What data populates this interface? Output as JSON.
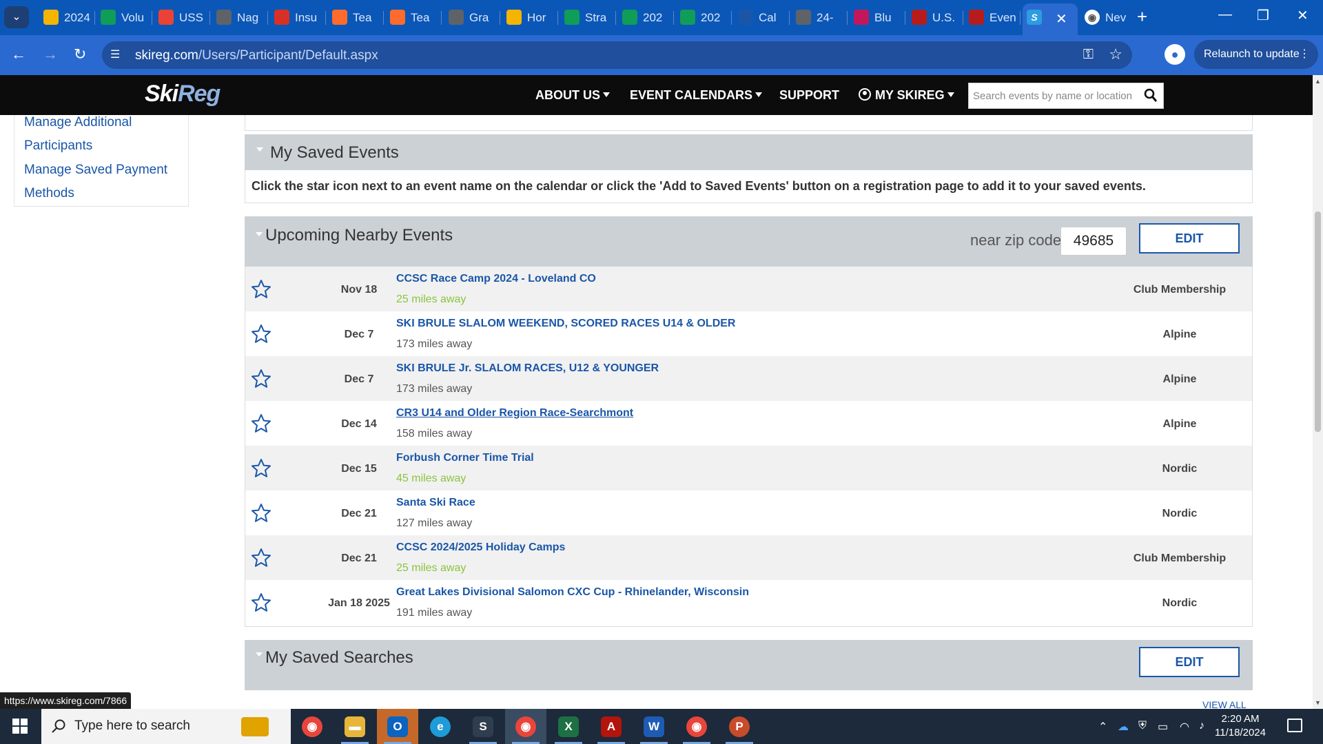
{
  "browser": {
    "tabs": [
      {
        "label": "2024",
        "icon": "google-drive-icon",
        "color": "#f4b400"
      },
      {
        "label": "Volu",
        "icon": "google-sheets-icon",
        "color": "#0f9d58"
      },
      {
        "label": "USS",
        "icon": "gmail-icon",
        "color": "#ea4335"
      },
      {
        "label": "Nag",
        "icon": "globe-icon",
        "color": "#5f6368"
      },
      {
        "label": "Insu",
        "icon": "pdf-icon",
        "color": "#d93025"
      },
      {
        "label": "Tea",
        "icon": "teamsnap-icon",
        "color": "#ff6b2c"
      },
      {
        "label": "Tea",
        "icon": "teamsnap-icon",
        "color": "#ff6b2c"
      },
      {
        "label": "Gra",
        "icon": "globe-icon",
        "color": "#5f6368"
      },
      {
        "label": "Hor",
        "icon": "google-drive-icon",
        "color": "#f4b400"
      },
      {
        "label": "Stra",
        "icon": "google-sheets-icon",
        "color": "#0f9d58"
      },
      {
        "label": "202",
        "icon": "google-sheets-icon",
        "color": "#0f9d58"
      },
      {
        "label": "202",
        "icon": "google-sheets-icon",
        "color": "#0f9d58"
      },
      {
        "label": "Cal",
        "icon": "site-icon",
        "color": "#1a56a8"
      },
      {
        "label": "24-",
        "icon": "globe-icon",
        "color": "#5f6368"
      },
      {
        "label": "Blu",
        "icon": "site-icon",
        "color": "#c2185b"
      },
      {
        "label": "U.S.",
        "icon": "site-icon",
        "color": "#b71c1c"
      },
      {
        "label": "Even",
        "icon": "site-icon",
        "color": "#b71c1c"
      }
    ],
    "active_tab_icon": "S",
    "active_tab_close": "✕",
    "last_tab": {
      "label": "Nev",
      "icon": "chrome-icon"
    },
    "new_tab": "+",
    "tab_menu": "⌄",
    "url_domain": "skireg.com",
    "url_path": "/Users/Participant/Default.aspx",
    "relaunch_label": "Relaunch to update",
    "status_url": "https://www.skireg.com/7866"
  },
  "site": {
    "logo_a": "Ski",
    "logo_b": "Reg",
    "nav": {
      "about": "ABOUT US",
      "calendars": "EVENT CALENDARS",
      "support": "SUPPORT",
      "account": "MY SKIREG"
    },
    "search_placeholder": "Search events by name or location"
  },
  "sidebar": {
    "links": [
      "Manage Additional",
      "Participants",
      "Manage Saved Payment",
      "Methods"
    ]
  },
  "saved_events": {
    "title": "My Saved Events",
    "info": "Click the star icon next to an event name on the calendar or click the 'Add to Saved Events' button on a registration page to add it to your saved events."
  },
  "nearby": {
    "title": "Upcoming Nearby Events",
    "zip_label": "near zip code",
    "zip_value": "49685",
    "edit_label": "EDIT",
    "events": [
      {
        "date": "Nov 18",
        "name": "CCSC Race Camp 2024 - Loveland CO",
        "distance": "25 miles away",
        "category": "Club Membership"
      },
      {
        "date": "Dec 7",
        "name": "SKI BRULE SLALOM WEEKEND, SCORED RACES U14 & OLDER",
        "distance": "173 miles away",
        "category": "Alpine"
      },
      {
        "date": "Dec 7",
        "name": "SKI BRULE Jr. SLALOM RACES, U12 & YOUNGER",
        "distance": "173 miles away",
        "category": "Alpine"
      },
      {
        "date": "Dec 14",
        "name": "CR3 U14 and Older Region Race-Searchmont",
        "distance": "158 miles away",
        "category": "Alpine"
      },
      {
        "date": "Dec 15",
        "name": "Forbush Corner Time Trial",
        "distance": "45 miles away",
        "category": "Nordic"
      },
      {
        "date": "Dec 21",
        "name": "Santa Ski Race",
        "distance": "127 miles away",
        "category": "Nordic"
      },
      {
        "date": "Dec 21",
        "name": "CCSC 2024/2025 Holiday Camps",
        "distance": "25 miles away",
        "category": "Club Membership"
      },
      {
        "date": "Jan 18 2025",
        "name": "Great Lakes Divisional Salomon CXC Cup - Rhinelander, Wisconsin",
        "distance": "191 miles away",
        "category": "Nordic"
      }
    ]
  },
  "saved_searches": {
    "title": "My Saved Searches",
    "edit_label": "EDIT",
    "view_all": "VIEW ALL"
  },
  "taskbar": {
    "search_placeholder": "Type here to search",
    "time": "2:20 AM",
    "date": "11/18/2024"
  },
  "colors": {
    "link": "#1a56a8",
    "near_distance": "#8ac43f",
    "panel_header": "#ccd1d6",
    "chrome_blue": "#2a6ad0"
  }
}
